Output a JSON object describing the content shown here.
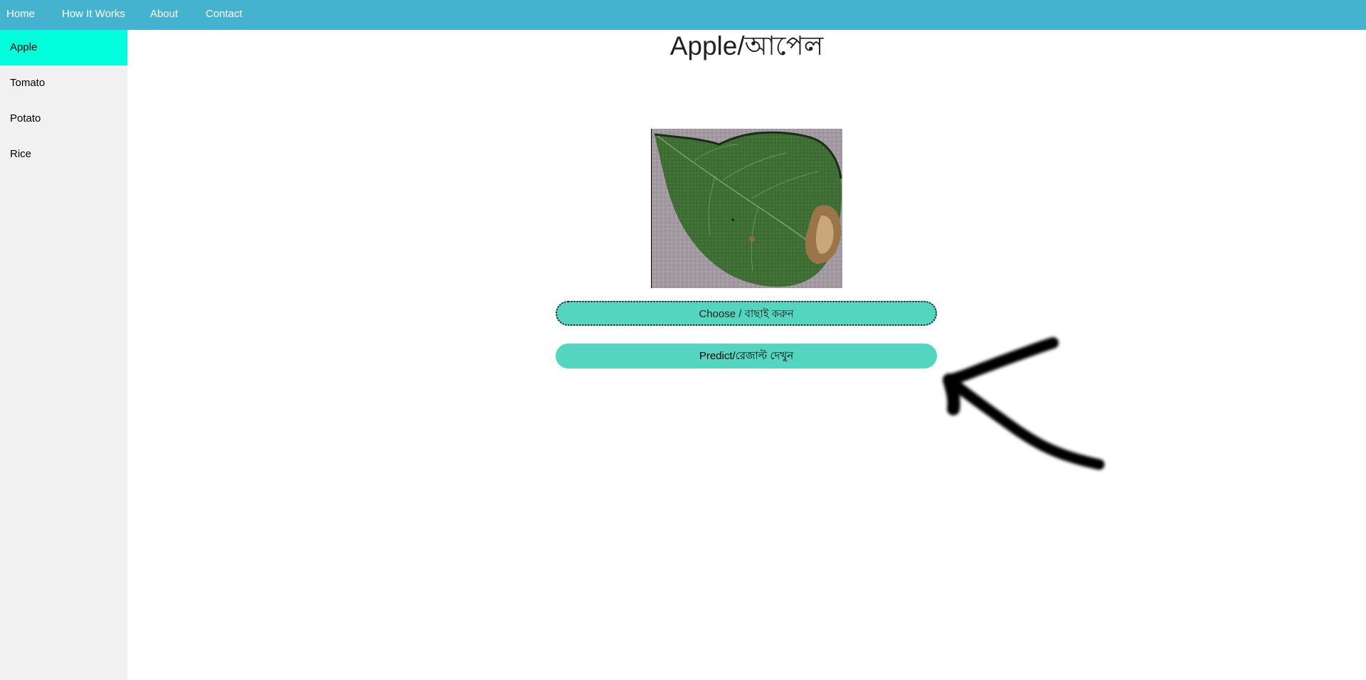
{
  "topnav": {
    "items": [
      {
        "label": "Home"
      },
      {
        "label": "How It Works"
      },
      {
        "label": "About"
      },
      {
        "label": "Contact"
      }
    ]
  },
  "sidebar": {
    "items": [
      {
        "label": "Apple",
        "active": true
      },
      {
        "label": "Tomato",
        "active": false
      },
      {
        "label": "Potato",
        "active": false
      },
      {
        "label": "Rice",
        "active": false
      }
    ]
  },
  "main": {
    "title": "Apple/আপেল",
    "choose_label": "Choose / বাছাই করুন",
    "predict_label": "Predict/রেজাল্ট দেখুন"
  },
  "colors": {
    "nav_bg": "#45b3cf",
    "sidebar_bg": "#f1f1f1",
    "sidebar_active": "#00ffdd",
    "button_bg": "#53d5bf"
  }
}
